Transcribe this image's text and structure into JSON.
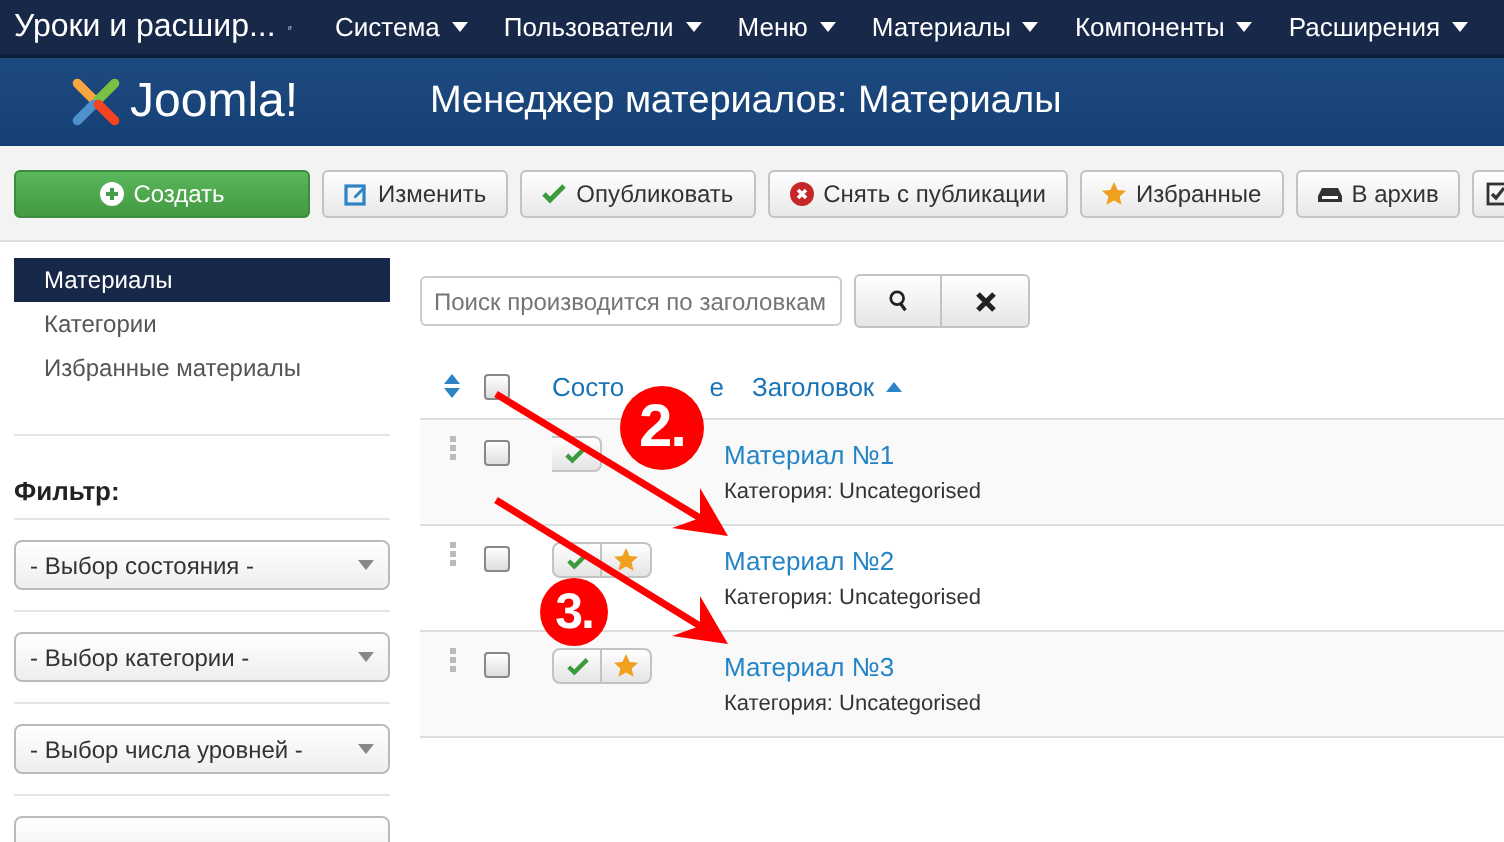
{
  "navbar": {
    "site": "Уроки и расшир...",
    "menus": [
      {
        "label": "Система"
      },
      {
        "label": "Пользователи"
      },
      {
        "label": "Меню"
      },
      {
        "label": "Материалы"
      },
      {
        "label": "Компоненты"
      },
      {
        "label": "Расширения"
      }
    ]
  },
  "header": {
    "logo": "Joomla!",
    "title": "Менеджер материалов: Материалы"
  },
  "toolbar": [
    {
      "kind": "create",
      "label": "Создать"
    },
    {
      "kind": "edit",
      "label": "Изменить"
    },
    {
      "kind": "publish",
      "label": "Опубликовать"
    },
    {
      "kind": "unpublish",
      "label": "Снять с публикации"
    },
    {
      "kind": "featured",
      "label": "Избранные"
    },
    {
      "kind": "archive",
      "label": "В архив"
    },
    {
      "kind": "checkin"
    }
  ],
  "sidebar": {
    "items": [
      {
        "label": "Материалы",
        "selected": true
      },
      {
        "label": "Категории",
        "selected": false
      },
      {
        "label": "Избранные материалы",
        "selected": false
      }
    ],
    "filter_title": "Фильтр:",
    "filters": [
      {
        "value": "- Выбор состояния -"
      },
      {
        "value": "- Выбор категории -"
      },
      {
        "value": "- Выбор числа уровней -"
      }
    ]
  },
  "search": {
    "placeholder": "Поиск производится по заголовкам"
  },
  "table": {
    "all_checked": false,
    "columns": [
      {
        "parts": [
          "Состо",
          "е"
        ]
      },
      {
        "parts": [
          "Заголовок"
        ]
      }
    ],
    "rows": [
      {
        "title": "Материал №1",
        "category": "Категория: Uncategorised",
        "published": true,
        "checked": false
      },
      {
        "title": "Материал №2",
        "category": "Категория: Uncategorised",
        "published": true,
        "featured": true,
        "checked": false
      },
      {
        "title": "Материал №3",
        "category": "Категория: Uncategorised",
        "published": true,
        "featured": true,
        "checked": false
      }
    ]
  },
  "annotations": [
    {
      "label": "2."
    },
    {
      "label": "3."
    }
  ]
}
